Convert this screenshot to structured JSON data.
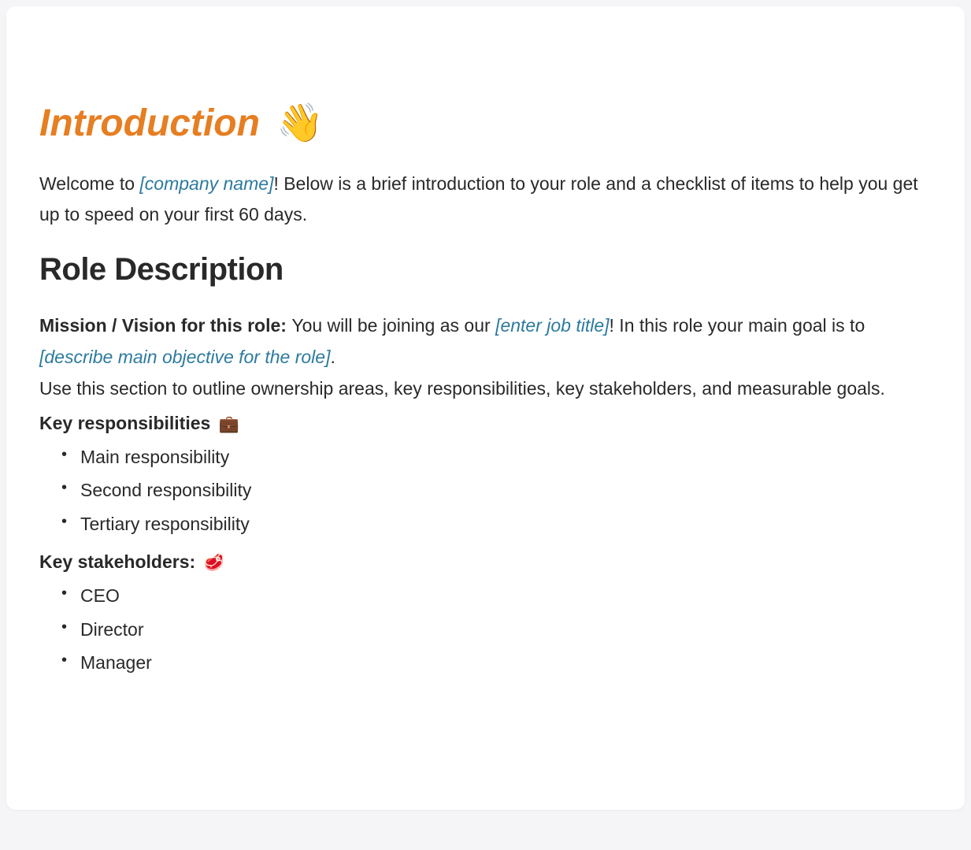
{
  "introduction": {
    "heading": "Introduction",
    "heading_emoji": "👋",
    "welcome_prefix": "Welcome to ",
    "company_placeholder": "[company name]",
    "welcome_suffix": "! Below is a brief introduction to your role and a checklist of items to help you get up to speed on your first 60 days."
  },
  "role_description": {
    "heading": "Role Description",
    "mission_label": "Mission / Vision for this role: ",
    "mission_prefix": "You will be joining as our ",
    "job_title_placeholder": "[enter job title]",
    "mission_mid": "! In this role your main goal is to ",
    "objective_placeholder": "[describe main objective for the role]",
    "mission_period": ".",
    "guidance": "Use this section to outline ownership areas, key responsibilities, key stakeholders, and measurable goals."
  },
  "responsibilities": {
    "label": "Key responsibilities",
    "emoji": "💼",
    "items": [
      "Main responsibility",
      "Second responsibility",
      "Tertiary responsibility"
    ]
  },
  "stakeholders": {
    "label": "Key stakeholders:",
    "emoji": "🥩",
    "items": [
      "CEO",
      "Director",
      "Manager"
    ]
  }
}
